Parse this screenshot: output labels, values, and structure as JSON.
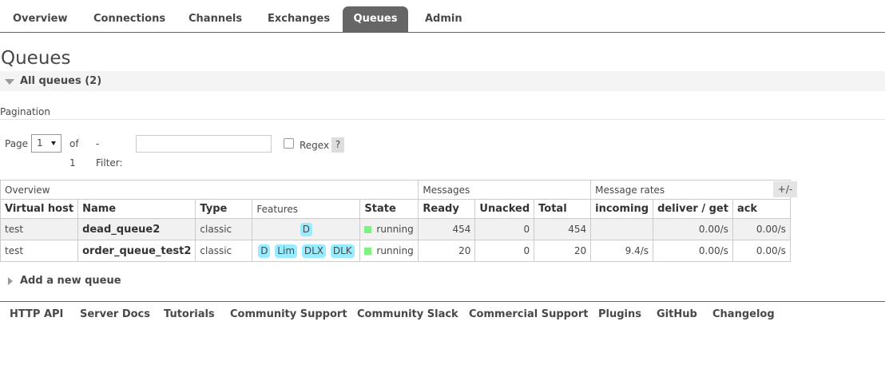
{
  "nav": {
    "tabs": [
      {
        "label": "Overview"
      },
      {
        "label": "Connections"
      },
      {
        "label": "Channels"
      },
      {
        "label": "Exchanges"
      },
      {
        "label": "Queues",
        "active": true
      },
      {
        "label": "Admin"
      }
    ]
  },
  "page": {
    "title": "Queues",
    "section_label": "All queues (2)"
  },
  "pagination": {
    "label": "Pagination",
    "page_label": "Page",
    "page_value": "1",
    "of_label": "of 1",
    "filter_label": "- Filter:",
    "filter_value": "",
    "regex_label": "Regex",
    "help_label": "?"
  },
  "table": {
    "groups": [
      "Overview",
      "Messages",
      "Message rates"
    ],
    "columns": [
      "Virtual host",
      "Name",
      "Type",
      "Features",
      "State",
      "Ready",
      "Unacked",
      "Total",
      "incoming",
      "deliver / get",
      "ack"
    ],
    "rows": [
      {
        "vhost": "test",
        "name": "dead_queue2",
        "type": "classic",
        "features": [
          "D"
        ],
        "state": "running",
        "ready": "454",
        "unacked": "0",
        "total": "454",
        "incoming": "",
        "deliver_get": "0.00/s",
        "ack": "0.00/s"
      },
      {
        "vhost": "test",
        "name": "order_queue_test2",
        "type": "classic",
        "features": [
          "D",
          "Lim",
          "DLX",
          "DLK"
        ],
        "state": "running",
        "ready": "20",
        "unacked": "0",
        "total": "20",
        "incoming": "9.4/s",
        "deliver_get": "0.00/s",
        "ack": "0.00/s"
      }
    ],
    "toggle_label": "+/-"
  },
  "add_queue": {
    "label": "Add a new queue"
  },
  "footer": {
    "links": [
      "HTTP API",
      "Server Docs",
      "Tutorials",
      "Community Support",
      "Community Slack",
      "Commercial Support",
      "Plugins",
      "GitHub",
      "Changelog"
    ]
  },
  "colors": {
    "active_tab": "#666666",
    "feature_badge": "#99ebff",
    "running_indicator": "#80f080"
  }
}
